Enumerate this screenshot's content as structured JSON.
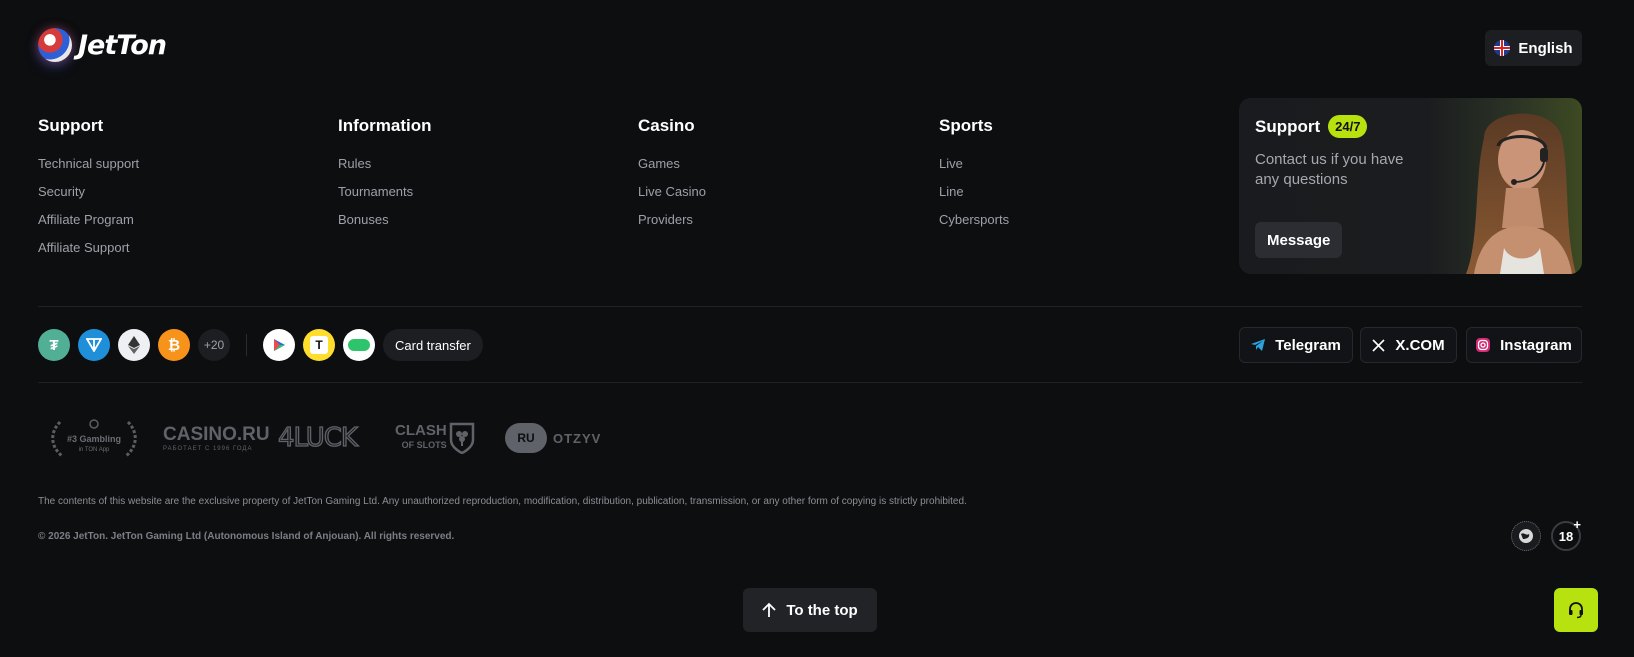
{
  "header": {
    "logo_text": "JetTon",
    "language": "English"
  },
  "columns": [
    {
      "title": "Support",
      "links": [
        "Technical support",
        "Security",
        "Affiliate Program",
        "Affiliate Support"
      ]
    },
    {
      "title": "Information",
      "links": [
        "Rules",
        "Tournaments",
        "Bonuses"
      ]
    },
    {
      "title": "Casino",
      "links": [
        "Games",
        "Live Casino",
        "Providers"
      ]
    },
    {
      "title": "Sports",
      "links": [
        "Live",
        "Line",
        "Cybersports"
      ]
    }
  ],
  "support_card": {
    "title": "Support",
    "badge": "24/7",
    "description": "Contact us if you have any questions",
    "button": "Message"
  },
  "payments": {
    "coins": [
      {
        "icon": "tether-icon",
        "color": "#50af95"
      },
      {
        "icon": "ton-icon",
        "color": "#1e8fd8"
      },
      {
        "icon": "ethereum-icon",
        "color": "#eef0f4"
      },
      {
        "icon": "bitcoin-icon",
        "color": "#f7931a"
      }
    ],
    "more": "+20",
    "methods": [
      {
        "icon": "play-pay-icon",
        "color": "#ffffff"
      },
      {
        "icon": "t-bank-icon",
        "color": "#ffdd2d"
      },
      {
        "icon": "sber-pay-icon",
        "color": "#ffffff"
      }
    ],
    "card_transfer": "Card transfer"
  },
  "social": [
    {
      "label": "Telegram",
      "icon": "telegram-icon"
    },
    {
      "label": "X.COM",
      "icon": "x-icon"
    },
    {
      "label": "Instagram",
      "icon": "instagram-icon"
    }
  ],
  "partners": {
    "gambling_line1": "#3 Gambling",
    "gambling_line2": "in TON App",
    "casino_ru": "CASINO.RU",
    "casino_ru_sub": "РАБОТАЕТ С 1996 ГОДА",
    "luck": "4LUCK",
    "clash1": "CLASH",
    "clash2": "OF SLOTS",
    "otzyv_ru": "RU",
    "otzyv": "OTZYV"
  },
  "legal": {
    "disclaimer": "The contents of this website are the exclusive property of JetTon Gaming Ltd. Any unauthorized reproduction, modification, distribution, publication, transmission, or any other form of copying is strictly prohibited.",
    "copyright": "© 2026 JetTon. JetTon Gaming Ltd (Autonomous Island of Anjouan). All rights reserved.",
    "age": "18",
    "age_plus": "+"
  },
  "to_top": "To the top"
}
